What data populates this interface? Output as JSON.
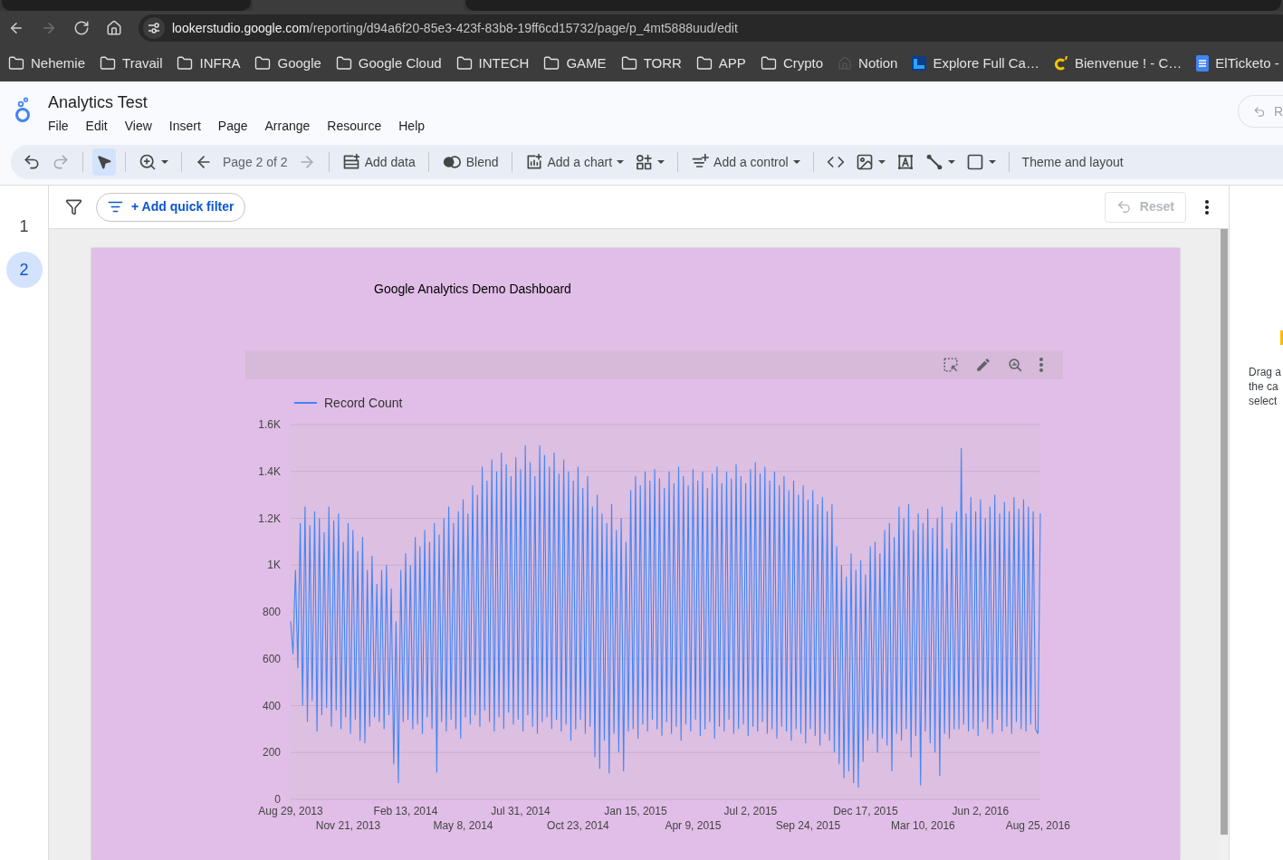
{
  "browser": {
    "tabs": [
      {
        "selected": false
      },
      {
        "selected": true
      },
      {
        "selected": false
      }
    ],
    "nav_buttons": [
      {
        "kind": "back",
        "disabled": false
      },
      {
        "kind": "forward",
        "disabled": true
      },
      {
        "kind": "reload",
        "disabled": false
      },
      {
        "kind": "home",
        "disabled": false
      }
    ],
    "address_bar": {
      "host": "lookerstudio.google.com",
      "path": "/reporting/d94a6f20-85e3-423f-83b8-19ff6cd15732/page/p_4mt5888uud/edit"
    },
    "bookmarks": [
      {
        "label": "Nehemie",
        "kind": "folder"
      },
      {
        "label": "Travail",
        "kind": "folder"
      },
      {
        "label": "INFRA",
        "kind": "folder"
      },
      {
        "label": "Google",
        "kind": "folder"
      },
      {
        "label": "Google Cloud",
        "kind": "folder"
      },
      {
        "label": "INTECH",
        "kind": "folder"
      },
      {
        "label": "GAME",
        "kind": "folder"
      },
      {
        "label": "TORR",
        "kind": "folder"
      },
      {
        "label": "APP",
        "kind": "folder"
      },
      {
        "label": "Crypto",
        "kind": "folder"
      },
      {
        "label": "Notion",
        "kind": "house"
      },
      {
        "label": "Explore Full Ca…",
        "kind": "tile"
      },
      {
        "label": "Bienvenue ! - C…",
        "kind": "letter"
      },
      {
        "label": "ElTicketo -",
        "kind": "document"
      }
    ]
  },
  "app": {
    "title": "Analytics Test",
    "menu": [
      "File",
      "Edit",
      "View",
      "Insert",
      "Page",
      "Arrange",
      "Resource",
      "Help"
    ],
    "header_button": {
      "label": "R",
      "disabled": true
    }
  },
  "toolbar": [
    {
      "kind": "undo",
      "disabled": false
    },
    {
      "kind": "redo",
      "disabled": true
    },
    {
      "kind": "separator"
    },
    {
      "kind": "pointer",
      "selected": true
    },
    {
      "kind": "separator"
    },
    {
      "kind": "zoom",
      "dropdown": true
    },
    {
      "kind": "separator"
    },
    {
      "kind": "previous",
      "disabled": false
    },
    {
      "kind": "label",
      "label": "Page 2 of 2"
    },
    {
      "kind": "next",
      "disabled": true
    },
    {
      "kind": "separator"
    },
    {
      "kind": "add-data",
      "label": "Add data"
    },
    {
      "kind": "separator"
    },
    {
      "kind": "blend",
      "label": "Blend"
    },
    {
      "kind": "separator"
    },
    {
      "kind": "add-chart",
      "label": "Add a chart",
      "dropdown": true
    },
    {
      "kind": "components",
      "dropdown": true
    },
    {
      "kind": "separator"
    },
    {
      "kind": "add-control",
      "label": "Add a control",
      "dropdown": true
    },
    {
      "kind": "separator"
    },
    {
      "kind": "embed"
    },
    {
      "kind": "image",
      "dropdown": true
    },
    {
      "kind": "textbox"
    },
    {
      "kind": "line",
      "dropdown": true
    },
    {
      "kind": "shape",
      "dropdown": true
    },
    {
      "kind": "separator"
    },
    {
      "kind": "theme",
      "label": "Theme and layout"
    }
  ],
  "pages": [
    {
      "label": "1",
      "selected": false
    },
    {
      "label": "2",
      "selected": true
    }
  ],
  "filter_bar": {
    "add_filter_label": "+ Add quick filter",
    "reset": {
      "label": "Reset",
      "disabled": true
    }
  },
  "report": {
    "title": "Google Analytics Demo Dashboard",
    "chart": {
      "chart_data": {
        "type": "line",
        "categories": [
          "Aug 29, 2013",
          null,
          null,
          null,
          null,
          null,
          null,
          null,
          null,
          null,
          null,
          null,
          null,
          null,
          null,
          null,
          null,
          null,
          null,
          null,
          null,
          null,
          null,
          null,
          "Nov 21, 2013",
          null,
          null,
          null,
          null,
          null,
          null,
          null,
          null,
          null,
          null,
          null,
          null,
          null,
          null,
          null,
          null,
          null,
          null,
          null,
          null,
          null,
          null,
          null,
          "Feb 13, 2014",
          null,
          null,
          null,
          null,
          null,
          null,
          null,
          null,
          null,
          null,
          null,
          null,
          null,
          null,
          null,
          null,
          null,
          null,
          null,
          null,
          null,
          null,
          null,
          "May 8, 2014",
          null,
          null,
          null,
          null,
          null,
          null,
          null,
          null,
          null,
          null,
          null,
          null,
          null,
          null,
          null,
          null,
          null,
          null,
          null,
          null,
          null,
          null,
          null,
          "Jul 31, 2014",
          null,
          null,
          null,
          null,
          null,
          null,
          null,
          null,
          null,
          null,
          null,
          null,
          null,
          null,
          null,
          null,
          null,
          null,
          null,
          null,
          null,
          null,
          null,
          "Oct 23, 2014",
          null,
          null,
          null,
          null,
          null,
          null,
          null,
          null,
          null,
          null,
          null,
          null,
          null,
          null,
          null,
          null,
          null,
          null,
          null,
          null,
          null,
          null,
          null,
          "Jan 15, 2015",
          null,
          null,
          null,
          null,
          null,
          null,
          null,
          null,
          null,
          null,
          null,
          null,
          null,
          null,
          null,
          null,
          null,
          null,
          null,
          null,
          null,
          null,
          null,
          "Apr 9, 2015",
          null,
          null,
          null,
          null,
          null,
          null,
          null,
          null,
          null,
          null,
          null,
          null,
          null,
          null,
          null,
          null,
          null,
          null,
          null,
          null,
          null,
          null,
          null,
          "Jul 2, 2015",
          null,
          null,
          null,
          null,
          null,
          null,
          null,
          null,
          null,
          null,
          null,
          null,
          null,
          null,
          null,
          null,
          null,
          null,
          null,
          null,
          null,
          null,
          null,
          "Sep 24, 2015",
          null,
          null,
          null,
          null,
          null,
          null,
          null,
          null,
          null,
          null,
          null,
          null,
          null,
          null,
          null,
          null,
          null,
          null,
          null,
          null,
          null,
          null,
          null,
          "Dec 17, 2015",
          null,
          null,
          null,
          null,
          null,
          null,
          null,
          null,
          null,
          null,
          null,
          null,
          null,
          null,
          null,
          null,
          null,
          null,
          null,
          null,
          null,
          null,
          null,
          "Mar 10, 2016",
          null,
          null,
          null,
          null,
          null,
          null,
          null,
          null,
          null,
          null,
          null,
          null,
          null,
          null,
          null,
          null,
          null,
          null,
          null,
          null,
          null,
          null,
          null,
          "Jun 2, 2016",
          null,
          null,
          null,
          null,
          null,
          null,
          null,
          null,
          null,
          null,
          null,
          null,
          null,
          null,
          null,
          null,
          null,
          null,
          null,
          null,
          null,
          null,
          null,
          "Aug 25, 2016",
          null
        ],
        "series": [
          {
            "name": "Record Count",
            "color": "#4285f4",
            "values": [
              760,
              620,
              980,
              560,
              1180,
              400,
              1250,
              330,
              1170,
              420,
              1230,
              290,
              1200,
              360,
              1140,
              390,
              1250,
              310,
              1190,
              380,
              1220,
              300,
              1100,
              350,
              1180,
              280,
              1150,
              340,
              1060,
              250,
              1120,
              240,
              980,
              310,
              1040,
              350,
              920,
              330,
              980,
              300,
              1000,
              360,
              900,
              150,
              760,
              70,
              980,
              330,
              1050,
              340,
              1000,
              300,
              1120,
              320,
              1080,
              280,
              1150,
              350,
              1100,
              300,
              1180,
              115,
              1130,
              330,
              1200,
              290,
              1250,
              340,
              1180,
              300,
              1230,
              260,
              1280,
              350,
              1220,
              320,
              1340,
              360,
              1300,
              310,
              1420,
              380,
              1360,
              330,
              1450,
              290,
              1400,
              350,
              1480,
              300,
              1430,
              370,
              1380,
              320,
              1460,
              340,
              1410,
              290,
              1510,
              360,
              1440,
              310,
              1380,
              280,
              1510,
              330,
              1470,
              350,
              1420,
              300,
              1480,
              340,
              1390,
              290,
              1450,
              320,
              1400,
              250,
              1360,
              300,
              1420,
              340,
              1330,
              280,
              1380,
              310,
              1250,
              180,
              1300,
              130,
              1220,
              250,
              1180,
              110,
              1260,
              280,
              1150,
              200,
              1200,
              120,
              1100,
              290,
              1320,
              300,
              1380,
              260,
              1340,
              320,
              1400,
              290,
              1360,
              340,
              1410,
              300,
              1370,
              270,
              1330,
              330,
              1400,
              280,
              1350,
              310,
              1420,
              250,
              1380,
              320,
              1340,
              290,
              1410,
              340,
              1360,
              270,
              1400,
              300,
              1330,
              330,
              1390,
              260,
              1420,
              310,
              1350,
              290,
              1400,
              340,
              1370,
              280,
              1430,
              300,
              1380,
              320,
              1350,
              270,
              1410,
              310,
              1440,
              290,
              1390,
              330,
              1420,
              280,
              1360,
              300,
              1400,
              260,
              1340,
              310,
              1380,
              290,
              1320,
              250,
              1360,
              300,
              1300,
              280,
              1340,
              240,
              1280,
              300,
              1320,
              270,
              1260,
              230,
              1290,
              280,
              1230,
              250,
              1260,
              200,
              1080,
              150,
              1000,
              90,
              950,
              120,
              1050,
              70,
              980,
              50,
              1020,
              160,
              960,
              250,
              1080,
              280,
              1100,
              200,
              1050,
              260,
              1150,
              230,
              1180,
              120,
              1120,
              280,
              1250,
              250,
              1200,
              300,
              1260,
              180,
              1150,
              270,
              1220,
              60,
              1180,
              290,
              1240,
              240,
              1160,
              200,
              1200,
              100,
              1250,
              280,
              1070,
              260,
              1180,
              300,
              1230,
              300,
              1500,
              320,
              1220,
              290,
              1290,
              300,
              1230,
              270,
              1280,
              330,
              1200,
              300,
              1250,
              280,
              1300,
              340,
              1220,
              290,
              1270,
              310,
              1230,
              280,
              1290,
              330,
              1240,
              300,
              1280,
              290,
              1250,
              320,
              1230,
              300,
              280,
              1220
            ]
          }
        ],
        "ylim": [
          0,
          1600
        ],
        "yticks": [
          {
            "value": 0,
            "label": "0"
          },
          {
            "value": 200,
            "label": "200"
          },
          {
            "value": 400,
            "label": "400"
          },
          {
            "value": 600,
            "label": "600"
          },
          {
            "value": 800,
            "label": "800"
          },
          {
            "value": 1000,
            "label": "1K"
          },
          {
            "value": 1200,
            "label": "1.2K"
          },
          {
            "value": 1400,
            "label": "1.4K"
          },
          {
            "value": 1600,
            "label": "1.6K"
          }
        ],
        "grid": true
      }
    }
  },
  "side_panel": {
    "hint_lines": [
      "Drag a",
      "the ca",
      "select"
    ]
  }
}
